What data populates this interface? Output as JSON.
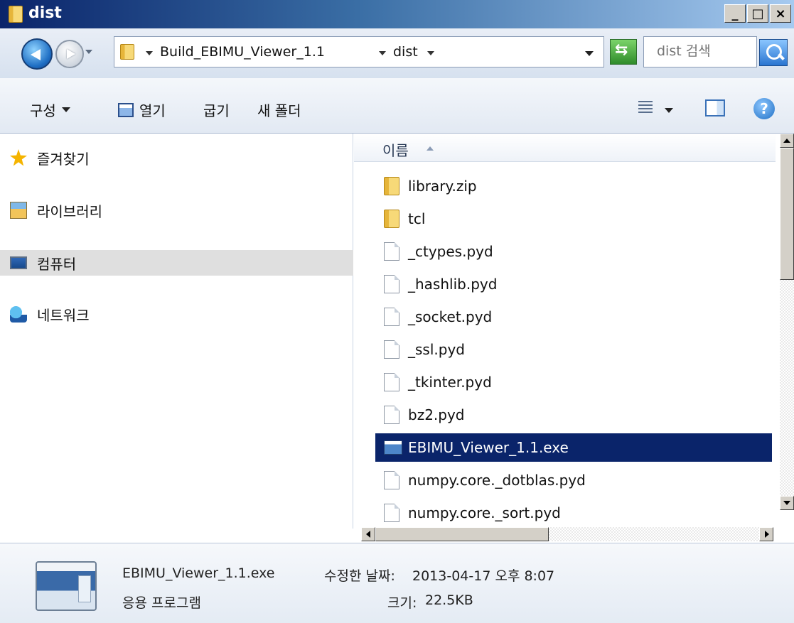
{
  "window": {
    "title": "dist",
    "controls": {
      "minimize": "_",
      "maximize": "□",
      "close": "×"
    }
  },
  "address": {
    "crumbs": [
      "Build_EBIMU_Viewer_1.1",
      "dist"
    ],
    "search_placeholder": "dist 검색"
  },
  "toolbar": {
    "organize": "구성",
    "open": "열기",
    "burn": "굽기",
    "new_folder": "새 폴더"
  },
  "navpane": {
    "items": [
      {
        "label": "즐겨찾기",
        "icon": "star-icon"
      },
      {
        "label": "라이브러리",
        "icon": "library-icon"
      },
      {
        "label": "컴퓨터",
        "icon": "computer-icon",
        "selected": true
      },
      {
        "label": "네트워크",
        "icon": "network-icon"
      }
    ]
  },
  "filelist": {
    "column_name": "이름",
    "files": [
      {
        "name": "library.zip",
        "type": "folder"
      },
      {
        "name": "tcl",
        "type": "folder"
      },
      {
        "name": "_ctypes.pyd",
        "type": "file"
      },
      {
        "name": "_hashlib.pyd",
        "type": "file"
      },
      {
        "name": "_socket.pyd",
        "type": "file"
      },
      {
        "name": "_ssl.pyd",
        "type": "file"
      },
      {
        "name": "_tkinter.pyd",
        "type": "file"
      },
      {
        "name": "bz2.pyd",
        "type": "file"
      },
      {
        "name": "EBIMU_Viewer_1.1.exe",
        "type": "exe",
        "selected": true
      },
      {
        "name": "numpy.core._dotblas.pyd",
        "type": "file"
      },
      {
        "name": "numpy.core._sort.pyd",
        "type": "file"
      }
    ]
  },
  "details": {
    "filename": "EBIMU_Viewer_1.1.exe",
    "modified_label": "수정한 날짜:",
    "modified_value": "2013-04-17 오후 8:07",
    "type": "응용 프로그램",
    "size_label": "크기:",
    "size_value": "22.5KB"
  },
  "colors": {
    "selection": "#0a246a",
    "nav_selected": "#dfdfdf"
  }
}
